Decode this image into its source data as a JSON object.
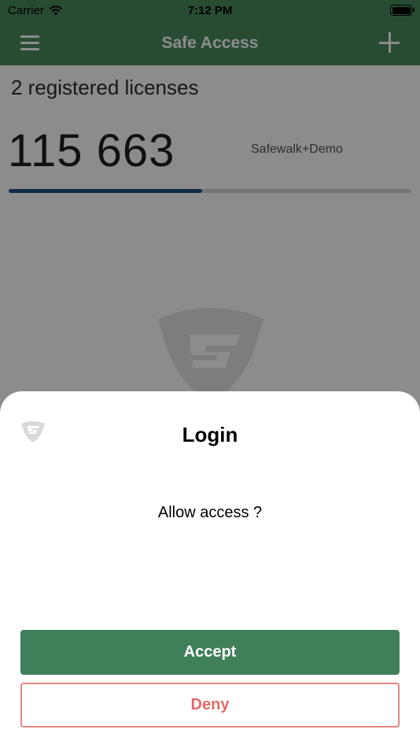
{
  "status_bar": {
    "carrier": "Carrier",
    "time": "7:12 PM"
  },
  "nav": {
    "title": "Safe Access"
  },
  "main": {
    "licenses_title": "2 registered licenses",
    "code": "115 663",
    "license_name": "Safewalk+Demo",
    "progress_fraction": 0.48
  },
  "dialog": {
    "title": "Login",
    "message": "Allow access ?",
    "accept_label": "Accept",
    "deny_label": "Deny"
  },
  "colors": {
    "brand_green": "#3f805a",
    "deny_red": "#e36a6a",
    "progress_blue": "#1f4f85"
  }
}
